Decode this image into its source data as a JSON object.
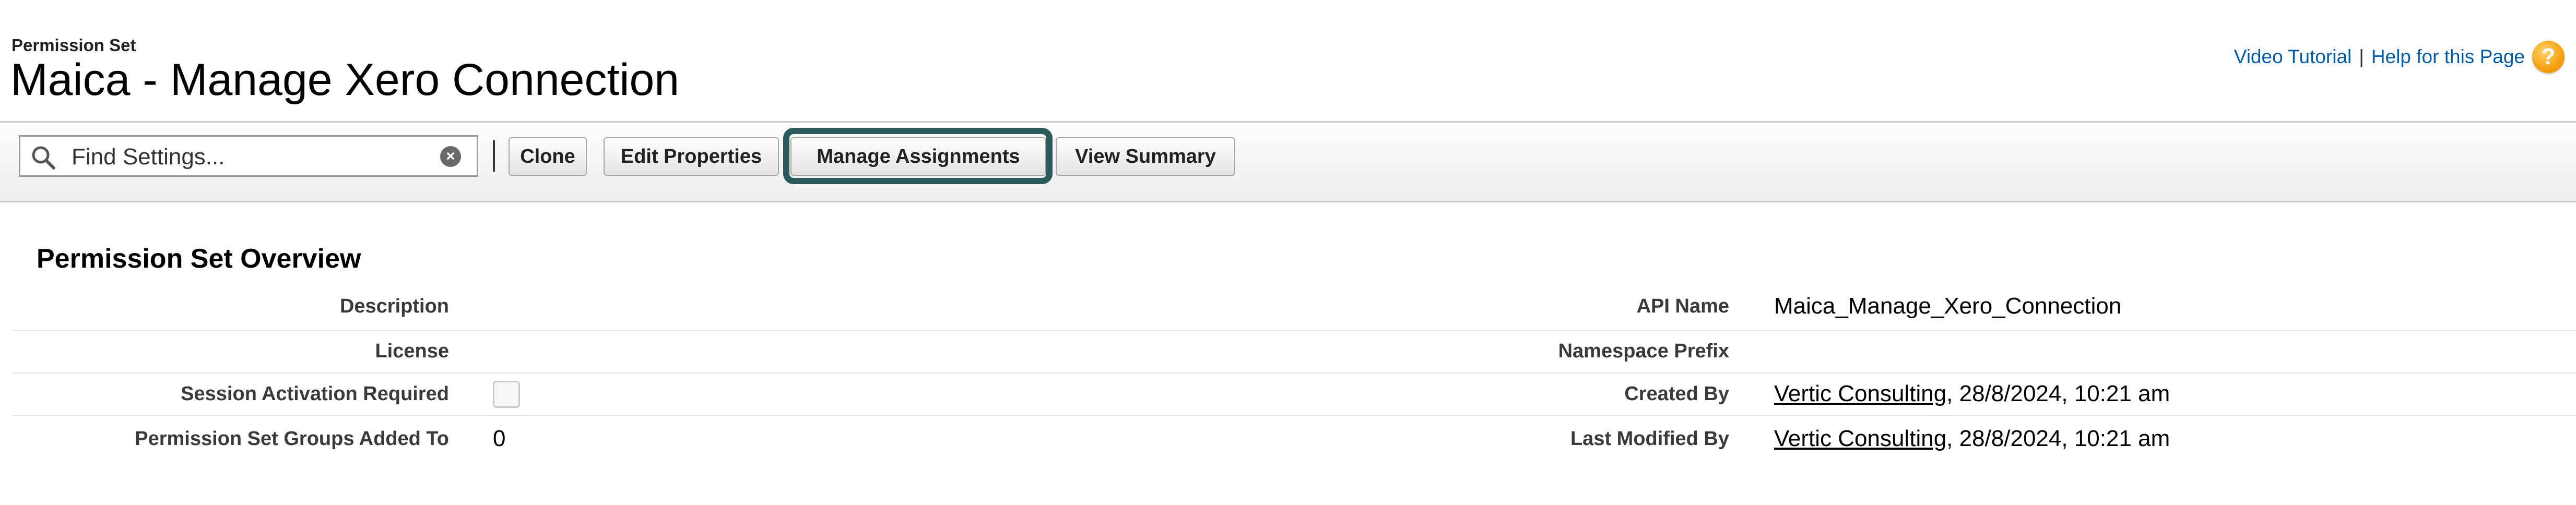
{
  "header": {
    "type_label": "Permission Set",
    "title": "Maica - Manage Xero Connection",
    "links": {
      "video_tutorial": "Video Tutorial",
      "separator": "|",
      "help": "Help for this Page",
      "help_icon_glyph": "?"
    }
  },
  "toolbar": {
    "search": {
      "placeholder": "Find Settings...",
      "value": ""
    },
    "clear_glyph": "×",
    "buttons": {
      "clone": "Clone",
      "edit_properties": "Edit Properties",
      "manage_assignments": "Manage Assignments",
      "view_summary": "View Summary"
    },
    "highlight_color": "#2a5a5a"
  },
  "overview": {
    "title": "Permission Set Overview",
    "left": {
      "description": {
        "label": "Description",
        "value": ""
      },
      "license": {
        "label": "License",
        "value": ""
      },
      "session_activation": {
        "label": "Session Activation Required",
        "checked": false
      },
      "groups_added_to": {
        "label": "Permission Set Groups Added To",
        "value": "0"
      }
    },
    "right": {
      "api_name": {
        "label": "API Name",
        "value": "Maica_Manage_Xero_Connection"
      },
      "namespace_prefix": {
        "label": "Namespace Prefix",
        "value": ""
      },
      "created_by": {
        "label": "Created By",
        "user": "Vertic Consulting",
        "date": ", 28/8/2024, 10:21 am"
      },
      "last_modified_by": {
        "label": "Last Modified By",
        "user": "Vertic Consulting",
        "date": ", 28/8/2024, 10:21 am"
      }
    }
  },
  "colors": {
    "link": "#015ba7",
    "help_icon": "#f39800",
    "highlight": "#2a5a5a"
  }
}
